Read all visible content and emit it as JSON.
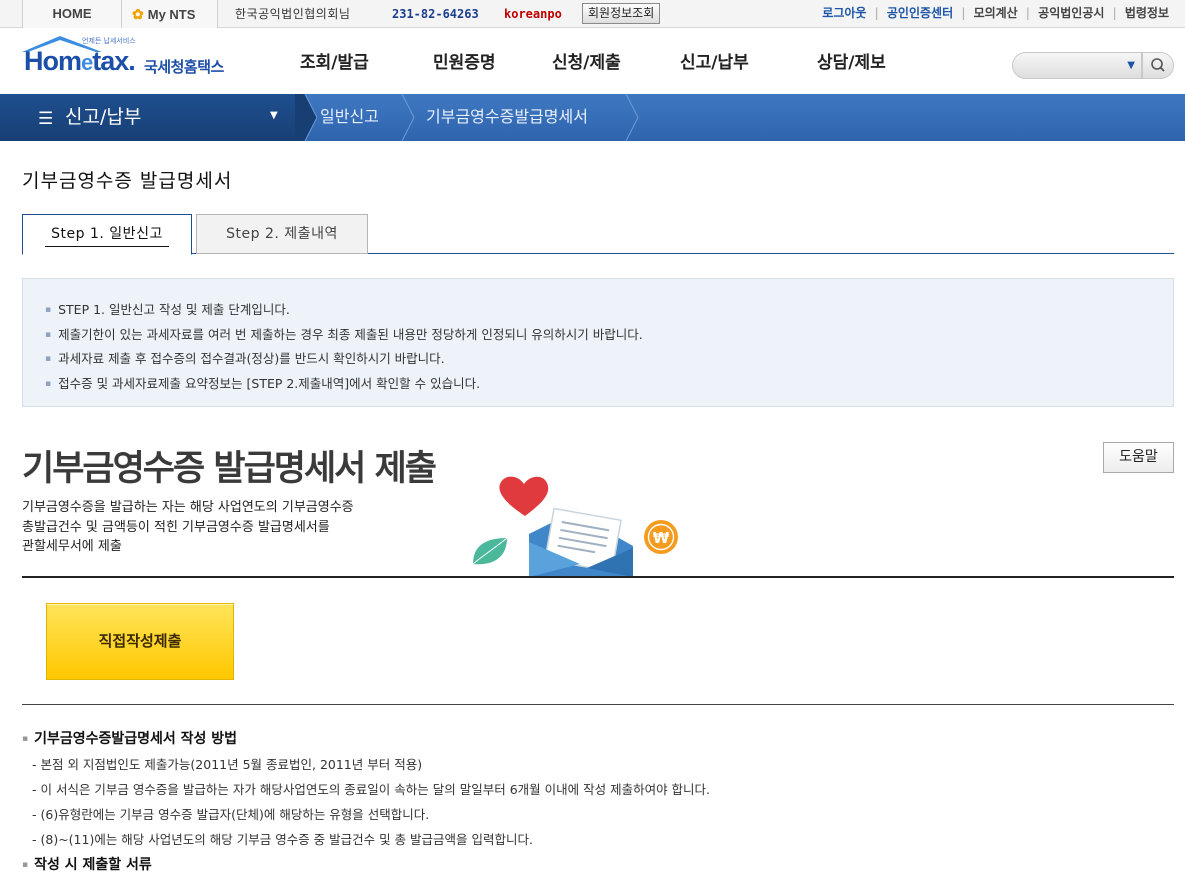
{
  "topbar": {
    "home": "HOME",
    "mynts": "My NTS",
    "org_name": "한국공익법인협의회님",
    "biz_no": "231-82-64263",
    "user_id": "koreanpo",
    "member_info_button": "회원정보조회",
    "links": [
      "로그아웃",
      "공인인증센터",
      "모의계산",
      "공익법인공시",
      "법령정보"
    ]
  },
  "header": {
    "logo_brand": "Hom",
    "logo_brand_e": "e",
    "logo_brand_end": "tax.",
    "logo_kr": "국세청홈택스",
    "logo_tagline": "언제든 납세서비스",
    "nav": [
      "조회/발급",
      "민원증명",
      "신청/제출",
      "신고/납부",
      "상담/제보"
    ]
  },
  "breadcrumb": {
    "menu": "신고/납부",
    "items": [
      "일반신고",
      "기부금영수증발급명세서"
    ]
  },
  "page": {
    "title": "기부금영수증 발급명세서",
    "tabs": [
      "Step 1. 일반신고",
      "Step 2. 제출내역"
    ]
  },
  "notice": [
    "STEP 1. 일반신고 작성 및 제출 단계입니다.",
    "제출기한이 있는 과세자료를 여러 번 제출하는 경우 최종 제출된 내용만 정당하게 인정되니 유의하시기 바랍니다.",
    "과세자료 제출 후 접수증의 접수결과(정상)를 반드시 확인하시기 바랍니다.",
    "접수증 및 과세자료제출 요약정보는 [STEP 2.제출내역]에서 확인할 수 있습니다."
  ],
  "main": {
    "heading": "기부금영수증 발급명세서 제출",
    "help_button": "도움말",
    "description_lines": [
      "기부금영수증을 발급하는 자는 해당 사업연도의 기부금영수증",
      "총발급건수 및 금액등이 적힌 기부금영수증 발급명세서를",
      "관할세무서에 제출"
    ],
    "direct_button": "직접작성제출"
  },
  "guide": {
    "heading1": "기부금영수증발급명세서 작성 방법",
    "items": [
      "본점 외 지점법인도 제출가능(2011년 5월 종료법인, 2011년 부터 적용)",
      "이 서식은 기부금 영수증을 발급하는 자가 해당사업연도의 종료일이 속하는 달의 말일부터 6개월 이내에 작성 제출하여야 합니다.",
      "(6)유형란에는 기부금 영수증 발급자(단체)에 해당하는 유형을 선택합니다.",
      "(8)~(11)에는 해당 사업년도의 해당 기부금 영수증 중 발급건수 및 총 발급금액을 입력합니다."
    ],
    "heading2": "작성 시 제출할 서류"
  },
  "colors": {
    "brand_blue": "#1e4fa8",
    "breadcrumb_dark": "#183f74",
    "breadcrumb_light": "#3f78c2",
    "action_yellow": "#ffc800",
    "notice_bg": "#eef3fa"
  }
}
